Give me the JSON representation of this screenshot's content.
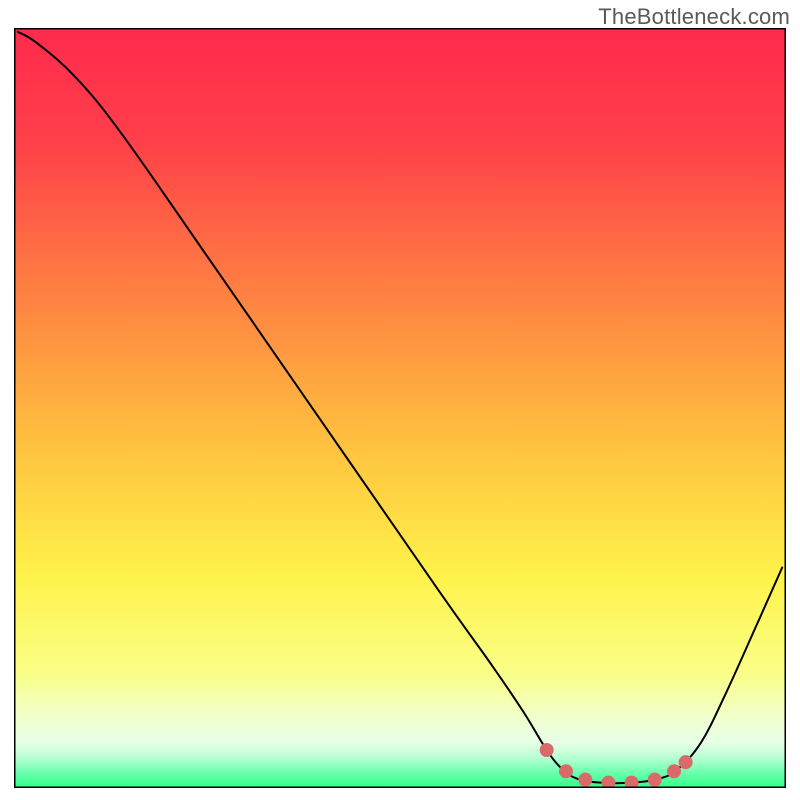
{
  "watermark": "TheBottleneck.com",
  "chart_data": {
    "type": "line",
    "title": "",
    "xlabel": "",
    "ylabel": "",
    "xlim": [
      0,
      100
    ],
    "ylim": [
      0,
      100
    ],
    "background_gradient_stops": [
      {
        "offset": 0,
        "color": "#ff2a4d"
      },
      {
        "offset": 15,
        "color": "#ff4049"
      },
      {
        "offset": 35,
        "color": "#ff8142"
      },
      {
        "offset": 55,
        "color": "#ffc23f"
      },
      {
        "offset": 72,
        "color": "#fff24a"
      },
      {
        "offset": 85,
        "color": "#f9ff87"
      },
      {
        "offset": 91,
        "color": "#f1ffcf"
      },
      {
        "offset": 94,
        "color": "#e6ffe8"
      },
      {
        "offset": 96,
        "color": "#b8ffd3"
      },
      {
        "offset": 98,
        "color": "#6affad"
      },
      {
        "offset": 100,
        "color": "#2eff88"
      }
    ],
    "series": [
      {
        "name": "bottleneck-curve",
        "color": "#000000",
        "points": [
          {
            "x": 0.5,
            "y": 99.5
          },
          {
            "x": 3,
            "y": 98
          },
          {
            "x": 8,
            "y": 93.5
          },
          {
            "x": 14,
            "y": 86
          },
          {
            "x": 25,
            "y": 70
          },
          {
            "x": 40,
            "y": 48
          },
          {
            "x": 55,
            "y": 26
          },
          {
            "x": 62,
            "y": 16
          },
          {
            "x": 66,
            "y": 10
          },
          {
            "x": 69,
            "y": 5
          },
          {
            "x": 71,
            "y": 2.5
          },
          {
            "x": 73,
            "y": 1.2
          },
          {
            "x": 76,
            "y": 0.7
          },
          {
            "x": 80,
            "y": 0.7
          },
          {
            "x": 83.5,
            "y": 1.2
          },
          {
            "x": 86,
            "y": 2.5
          },
          {
            "x": 89,
            "y": 6
          },
          {
            "x": 92,
            "y": 12
          },
          {
            "x": 96,
            "y": 21
          },
          {
            "x": 99.5,
            "y": 29
          }
        ]
      },
      {
        "name": "optimal-range",
        "color": "#d96a6a",
        "points": [
          {
            "x": 69,
            "y": 5
          },
          {
            "x": 71.5,
            "y": 2.2
          },
          {
            "x": 74,
            "y": 1.1
          },
          {
            "x": 77,
            "y": 0.7
          },
          {
            "x": 80,
            "y": 0.7
          },
          {
            "x": 83,
            "y": 1.1
          },
          {
            "x": 85.5,
            "y": 2.2
          },
          {
            "x": 87,
            "y": 3.4
          }
        ]
      }
    ]
  }
}
